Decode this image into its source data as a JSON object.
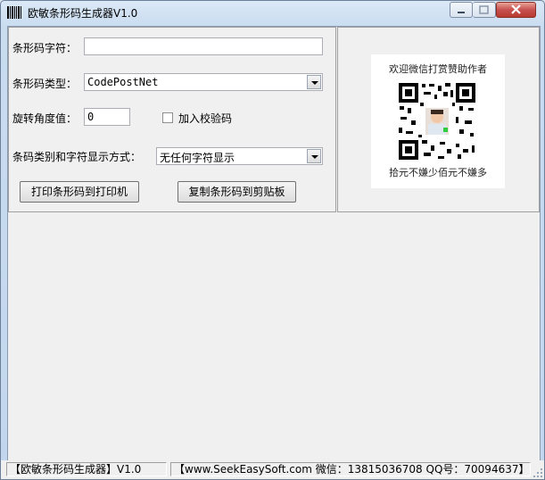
{
  "window": {
    "title": "欧敏条形码生成器V1.0",
    "app_icon": "barcode-icon",
    "controls": [
      "minimize-icon",
      "maximize-icon",
      "close-icon"
    ]
  },
  "form": {
    "barcode_text_label": "条形码字符：",
    "barcode_text_value": "",
    "barcode_type_label": "条形码类型：",
    "barcode_type_value": "CodePostNet",
    "rotation_label": "旋转角度值：",
    "rotation_value": "0",
    "checksum_label": "加入校验码",
    "checksum_checked": false,
    "display_mode_label": "条码类别和字符显示方式：",
    "display_mode_value": "无任何字符显示",
    "print_button": "打印条形码到打印机",
    "copy_button": "复制条形码到剪贴板"
  },
  "donate": {
    "top_text": "欢迎微信打赏赞助作者",
    "bottom_text": "拾元不嫌少佰元不嫌多",
    "qr_icon": "qr-code-icon"
  },
  "status": {
    "app_name": "【欧敏条形码生成器】V1.0",
    "contact": "【www.SeekEasySoft.com 微信：13815036708 QQ号：70094637】"
  },
  "colors": {
    "titlebar": "#c9dcf0",
    "client_bg": "#f0f0f0",
    "close_button": "#c75050"
  }
}
